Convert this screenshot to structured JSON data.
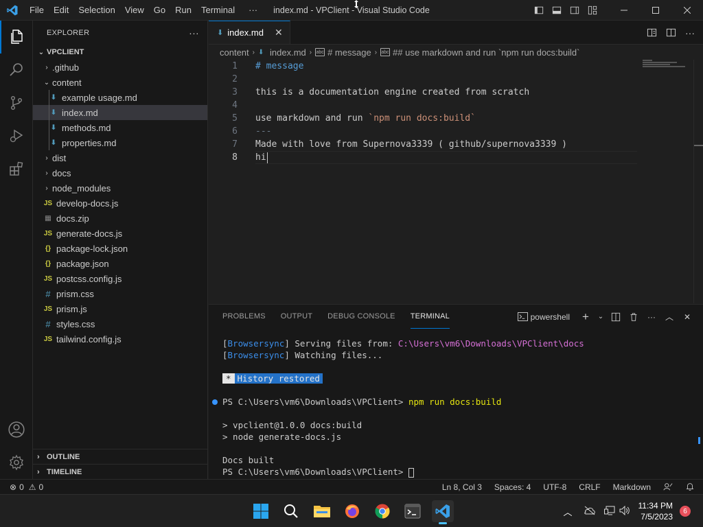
{
  "window": {
    "title": "index.md - VPClient - Visual Studio Code",
    "menu": [
      "File",
      "Edit",
      "Selection",
      "View",
      "Go",
      "Run",
      "Terminal"
    ],
    "more": "···"
  },
  "sidebar": {
    "title": "EXPLORER",
    "more": "···",
    "root": "VPCLIENT",
    "items": [
      {
        "label": ".github",
        "kind": "folder",
        "open": false
      },
      {
        "label": "content",
        "kind": "folder",
        "open": true
      },
      {
        "label": "example usage.md",
        "kind": "md"
      },
      {
        "label": "index.md",
        "kind": "md",
        "selected": true
      },
      {
        "label": "methods.md",
        "kind": "md"
      },
      {
        "label": "properties.md",
        "kind": "md"
      },
      {
        "label": "dist",
        "kind": "folder",
        "open": false
      },
      {
        "label": "docs",
        "kind": "folder",
        "open": false
      },
      {
        "label": "node_modules",
        "kind": "folder",
        "open": false
      },
      {
        "label": "develop-docs.js",
        "kind": "js"
      },
      {
        "label": "docs.zip",
        "kind": "zip"
      },
      {
        "label": "generate-docs.js",
        "kind": "js"
      },
      {
        "label": "package-lock.json",
        "kind": "json"
      },
      {
        "label": "package.json",
        "kind": "json"
      },
      {
        "label": "postcss.config.js",
        "kind": "js"
      },
      {
        "label": "prism.css",
        "kind": "css"
      },
      {
        "label": "prism.js",
        "kind": "js"
      },
      {
        "label": "styles.css",
        "kind": "css"
      },
      {
        "label": "tailwind.config.js",
        "kind": "js"
      }
    ],
    "outline": "OUTLINE",
    "timeline": "TIMELINE"
  },
  "icons": {
    "js": "JS",
    "json": "{}",
    "css": "#",
    "md": "⬇",
    "zip": "▦"
  },
  "editor": {
    "tab_label": "index.md",
    "breadcrumb": [
      "content",
      "index.md",
      "# message",
      "## use markdown and run `npm run docs:build`"
    ],
    "lines": [
      "# message",
      "",
      "this is a documentation engine created from scratch",
      "",
      "use markdown and run `npm run docs:build`",
      "---",
      "Made with love from Supernova3339 ( github/supernova3339 )",
      "hi"
    ],
    "line_numbers": [
      "1",
      "2",
      "3",
      "4",
      "5",
      "6",
      "7",
      "8"
    ],
    "line5_prefix": "use markdown and run ",
    "line5_code": "`npm run docs:build`"
  },
  "panel": {
    "tabs": [
      "PROBLEMS",
      "OUTPUT",
      "DEBUG CONSOLE",
      "TERMINAL"
    ],
    "active_tab": "TERMINAL",
    "shell": "powershell",
    "terminal": {
      "bs1_tag": "Browsersync",
      "bs1_text": " Serving files from: ",
      "bs1_path": "C:\\Users\\vm6\\Downloads\\VPClient\\docs",
      "bs2_tag": "Browsersync",
      "bs2_text": " Watching files...",
      "history_star": "*",
      "history": "History restored",
      "prompt1": "PS C:\\Users\\vm6\\Downloads\\VPClient> ",
      "cmd1": "npm run docs:build",
      "out1": "> vpclient@1.0.0 docs:build",
      "out2": "> node generate-docs.js",
      "out3": "Docs built",
      "prompt2": "PS C:\\Users\\vm6\\Downloads\\VPClient> "
    }
  },
  "status": {
    "errors": "0",
    "warnings": "0",
    "position": "Ln 8, Col 3",
    "spaces": "Spaces: 4",
    "encoding": "UTF-8",
    "eol": "CRLF",
    "language": "Markdown"
  },
  "taskbar": {
    "time": "11:34 PM",
    "date": "7/5/2023",
    "notifications": "6"
  },
  "colors": {
    "accent": "#0078d4",
    "heading": "#569cd6",
    "code": "#ce9178",
    "term_cyan": "#3b8eea",
    "term_magenta": "#d670d6",
    "term_yellow": "#e5e510"
  }
}
